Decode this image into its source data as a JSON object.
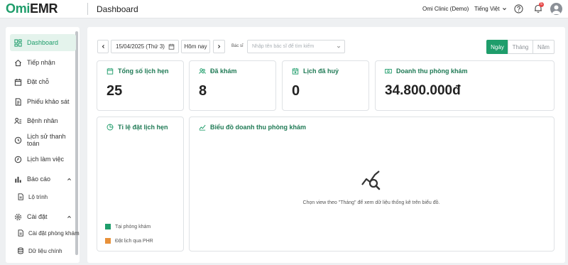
{
  "header": {
    "logo_omi": "Omi",
    "logo_emr": "EMR",
    "page_title": "Dashboard",
    "clinic_name": "Omi Clinic (Demo)",
    "language": "Tiếng Việt",
    "notification_count": "5"
  },
  "sidebar": {
    "items": [
      {
        "label": "Dashboard"
      },
      {
        "label": "Tiếp nhận"
      },
      {
        "label": "Đặt chỗ"
      },
      {
        "label": "Phiếu khảo sát"
      },
      {
        "label": "Bệnh nhân"
      },
      {
        "label": "Lịch sử thanh toán"
      },
      {
        "label": "Lịch làm việc"
      },
      {
        "label": "Báo cáo"
      },
      {
        "label": "Lộ trình"
      },
      {
        "label": "Cài đặt"
      },
      {
        "label": "Cài đặt phòng khám"
      },
      {
        "label": "Dữ liệu chính"
      }
    ]
  },
  "filters": {
    "date": "15/04/2025",
    "weekday": "(Thứ 3)",
    "today_label": "Hôm nay",
    "doctor_label": "Bác sĩ",
    "doctor_placeholder": "Nhập tên bác sĩ để tìm kiếm",
    "view_options": [
      "Ngày",
      "Tháng",
      "Năm"
    ],
    "selected_view": "Ngày"
  },
  "stats": {
    "total_appointments": {
      "label": "Tổng số lịch hẹn",
      "value": "25"
    },
    "examined": {
      "label": "Đã khám",
      "value": "8"
    },
    "cancelled": {
      "label": "Lịch đã huỷ",
      "value": "0"
    },
    "revenue": {
      "label": "Doanh thu phòng khám",
      "value": "34.800.000đ"
    }
  },
  "ratio_card": {
    "title": "Tỉ lệ đặt lịch hẹn",
    "legend": [
      {
        "label": "Tại phòng khám",
        "color": "#1f9d6b"
      },
      {
        "label": "Đặt lịch qua PHR",
        "color": "#e8913a"
      }
    ]
  },
  "revenue_chart": {
    "title": "Biểu đồ doanh thu phòng khám",
    "empty_message": "Chọn view theo \"Tháng\" để xem dữ liệu thống kê trên biểu đồ."
  },
  "colors": {
    "accent": "#1f9d6b",
    "title_green": "#1f7a55"
  }
}
